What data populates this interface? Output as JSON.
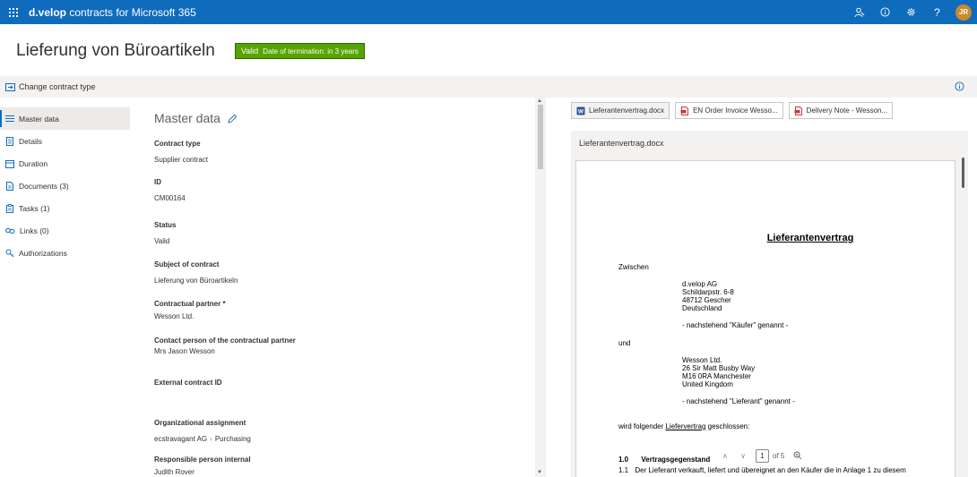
{
  "topbar": {
    "brand_bold": "d.velop",
    "brand_rest": "contracts for Microsoft 365",
    "avatar_initials": "JR",
    "icons": [
      "people-icon",
      "info-icon",
      "settings-icon",
      "help-icon"
    ],
    "help_glyph": "?",
    "accent_color": "#0f6cbd"
  },
  "header": {
    "title": "Lieferung von Büroartikeln",
    "status_badge": {
      "label": "Valid",
      "detail": "Date of termination: in 3 years",
      "color": "#57a300"
    }
  },
  "commandbar": {
    "change_contract_type": "Change contract type"
  },
  "sidebar": {
    "items": [
      {
        "label": "Master data",
        "icon": "list-icon",
        "active": true
      },
      {
        "label": "Details",
        "icon": "document-icon"
      },
      {
        "label": "Duration",
        "icon": "calendar-icon"
      },
      {
        "label": "Documents (3)",
        "icon": "file-icon"
      },
      {
        "label": "Tasks (1)",
        "icon": "clipboard-icon"
      },
      {
        "label": "Links (0)",
        "icon": "link-icon"
      },
      {
        "label": "Authorizations",
        "icon": "key-icon"
      }
    ]
  },
  "master_data": {
    "title": "Master data",
    "fields": [
      {
        "label": "Contract type",
        "value": "Supplier contract"
      },
      {
        "label": "ID",
        "value": "CM00164"
      },
      {
        "label": "Status",
        "value": "Valid"
      },
      {
        "label": "Subject of contract",
        "value": "Lieferung von Büroartikeln"
      },
      {
        "label": "Contractual partner *",
        "value": "Wesson Ltd."
      },
      {
        "label": "Contact person of the contractual partner",
        "value": "Mrs Jason Wesson"
      },
      {
        "label": "External contract ID",
        "value": ""
      },
      {
        "label": "Organizational assignment",
        "value_parts": [
          "ecstravagant AG",
          "Purchasing"
        ]
      },
      {
        "label": "Responsible person internal",
        "value": "Judith Rover"
      }
    ]
  },
  "documents": {
    "tabs": [
      {
        "label": "Lieferantenvertrag.docx",
        "icon": "word-icon",
        "active": true
      },
      {
        "label": "EN Order Invoice Wesso...",
        "icon": "pdf-icon"
      },
      {
        "label": "Delivery Note - Wesson...",
        "icon": "pdf-icon"
      }
    ],
    "preview_title": "Lieferantenvertrag.docx",
    "page": {
      "heading": "Lieferantenvertrag",
      "zwischen": "Zwischen",
      "party1": [
        "d.velop AG",
        "Schildarpstr. 6-8",
        "48712 Gescher",
        "Deutschland"
      ],
      "party1_note": "- nachstehend \"Käufer\" genannt -",
      "und": "und",
      "party2": [
        "Wesson Ltd.",
        "26 Sir Matt Busby Way",
        "M16 0RA Manchester",
        "United Kingdom"
      ],
      "party2_note": "- nachstehend \"Lieferant\" genannt -",
      "closing_pre": "wird folgender",
      "closing_link": "Liefervertrag",
      "closing_post": "geschlossen:",
      "section_no": "1.0",
      "section_title": "Vertragsgegenstand",
      "clause_no": "1.1",
      "clause_text": "Der Lieferant verkauft, liefert und übereignet an den Käufer die in Anlage 1 zu diesem"
    },
    "pager": {
      "current": "1",
      "of_label": "of 5"
    }
  }
}
